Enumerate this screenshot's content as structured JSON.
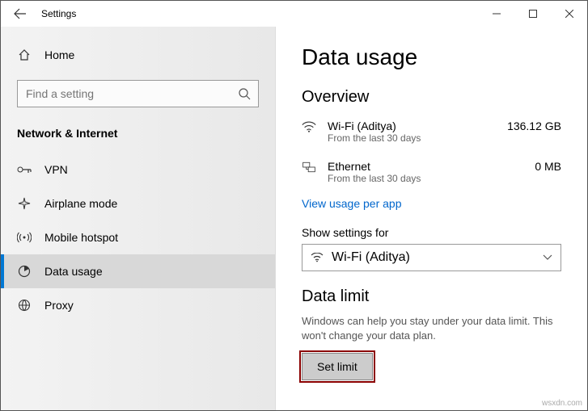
{
  "titlebar": {
    "app_title": "Settings"
  },
  "sidebar": {
    "home_label": "Home",
    "search_placeholder": "Find a setting",
    "section_header": "Network & Internet",
    "items": [
      {
        "icon": "vpn-icon",
        "label": "VPN"
      },
      {
        "icon": "airplane-icon",
        "label": "Airplane mode"
      },
      {
        "icon": "hotspot-icon",
        "label": "Mobile hotspot"
      },
      {
        "icon": "data-usage-icon",
        "label": "Data usage"
      },
      {
        "icon": "proxy-icon",
        "label": "Proxy"
      }
    ]
  },
  "main": {
    "page_title": "Data usage",
    "overview_heading": "Overview",
    "networks": [
      {
        "icon": "wifi-icon",
        "name": "Wi-Fi (Aditya)",
        "sub": "From the last 30 days",
        "value": "136.12 GB"
      },
      {
        "icon": "ethernet-icon",
        "name": "Ethernet",
        "sub": "From the last 30 days",
        "value": "0 MB"
      }
    ],
    "usage_link": "View usage per app",
    "show_settings_label": "Show settings for",
    "selected_network": "Wi-Fi (Aditya)",
    "data_limit_heading": "Data limit",
    "data_limit_desc": "Windows can help you stay under your data limit. This won't change your data plan.",
    "set_limit_button": "Set limit"
  },
  "watermark": "wsxdn.com"
}
